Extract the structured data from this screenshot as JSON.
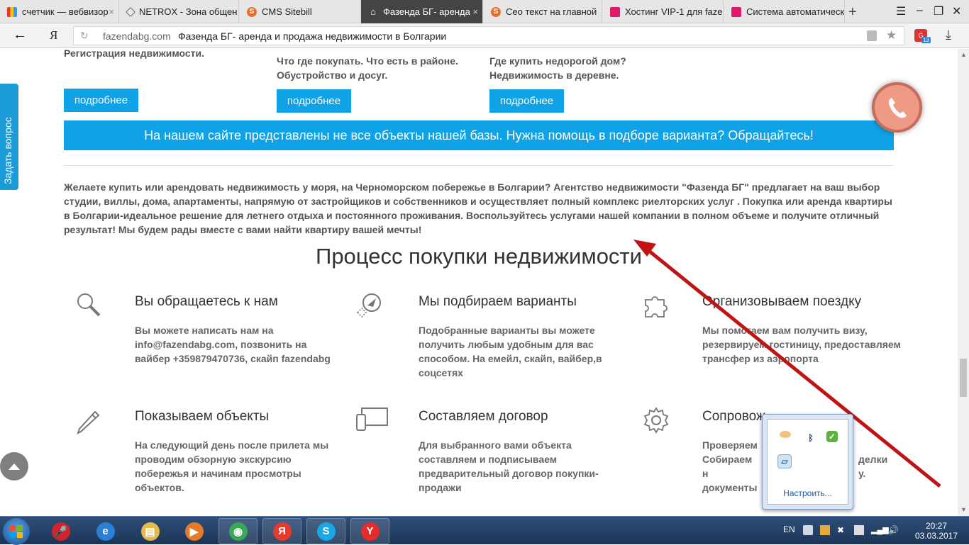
{
  "browser": {
    "tabs": [
      {
        "title": "счетчик — вебвизор",
        "active": false,
        "favicon": "yandex-metrica-icon"
      },
      {
        "title": "NETROX - Зона общен",
        "active": false,
        "favicon": "netrox-icon"
      },
      {
        "title": "CMS Sitebill",
        "active": false,
        "favicon": "sitebill-icon"
      },
      {
        "title": "Фазенда БГ- аренда",
        "active": true,
        "favicon": "house-icon"
      },
      {
        "title": "Сео текст на главной",
        "active": false,
        "favicon": "sitebill-icon"
      },
      {
        "title": "Хостинг VIP-1 для faze",
        "active": false,
        "favicon": "hosting-icon"
      },
      {
        "title": "Система автоматическ",
        "active": false,
        "favicon": "hosting-icon"
      }
    ],
    "address": {
      "domain": "fazendabg.com",
      "page_title": "Фазенда БГ- аренда и продажа недвижимости в Болгарии",
      "yandex_logo": "Я",
      "extension_badge": "13"
    }
  },
  "page": {
    "columns": [
      {
        "text": "Регистрация недвижимости.",
        "button": "подробнее"
      },
      {
        "text": "Что где покупать. Что есть в районе. Обустройство и досуг.",
        "button": "подробнее"
      },
      {
        "text": "Где купить недорогой дом? Недвижимость в деревне.",
        "button": "подробнее"
      }
    ],
    "banner": "На нашем сайте представлены не все объекты нашей базы. Нужна помощь в подборе варианта? Обращайтесь!",
    "intro": "Желаете купить или арендовать недвижимость у моря, на Черноморском побережье в Болгарии? Агентство недвижимости \"Фазенда БГ\" предлагает на ваш выбор студии, виллы, дома, апартаменты, напрямую от застройщиков и собственников и осуществляет полный комплекс риелторских услуг . Покупка или аренда квартиры в Болгарии-идеальное решение для летнего отдыха и постоянного проживания. Воспользуйтесь услугами нашей компании в полном объеме и получите отличный результат! Мы будем рады вместе с вами найти квартиру вашей мечты!",
    "process_title": "Процесс покупки недвижимости",
    "steps": [
      {
        "title": "Вы обращаетесь к нам",
        "text": "Вы можете написать нам на info@fazendabg.com, позвонить на вайбер +359879470736, скайп fazendabg",
        "icon": "search-icon"
      },
      {
        "title": "Мы подбираем варианты",
        "text": "Подобранные варианты вы можете получить любым удобным для вас способом. На емейл, скайп, вайбер,в соцсетях",
        "icon": "compass-icon"
      },
      {
        "title": "Организовываем поездку",
        "text": "Мы помогаем вам получить визу, резервируем гостиницу, предоставляем трансфер из аэропорта",
        "icon": "puzzle-icon"
      },
      {
        "title": "Показываем объекты",
        "text": "На следующий день после прилета мы проводим обзорную экскурсию побережья и начинам просмотры объектов.",
        "icon": "pencil-icon"
      },
      {
        "title": "Составляем договор",
        "text": "Для выбранного вами объекта составляем и подписываем предварительный договор покупки-продажи",
        "icon": "devices-icon"
      },
      {
        "title": "Сопровож",
        "text": "Проверяем Собираем н документы",
        "text_right": "делки у.",
        "icon": "gear-icon"
      }
    ],
    "ask_question": "Задать вопрос"
  },
  "tray_popup": {
    "customize": "Настроить..."
  },
  "taskbar": {
    "lang": "EN",
    "time": "20:27",
    "date": "03.03.2017",
    "items": [
      {
        "icon": "microphone-icon",
        "glyph": "🎤",
        "color": "#d0232a"
      },
      {
        "icon": "internet-explorer-icon",
        "glyph": "e",
        "color": "#2b7fd4"
      },
      {
        "icon": "folder-icon",
        "glyph": "▤",
        "color": "#e5b94a"
      },
      {
        "icon": "media-player-icon",
        "glyph": "▶",
        "color": "#e47a2a"
      },
      {
        "icon": "chrome-icon",
        "glyph": "◉",
        "color": "#3aa757"
      },
      {
        "icon": "yandex-browser-icon",
        "glyph": "Я",
        "color": "#e53a2e"
      },
      {
        "icon": "skype-icon",
        "glyph": "S",
        "color": "#1aa7e8"
      },
      {
        "icon": "yandex-icon",
        "glyph": "Y",
        "color": "#e52b2b"
      }
    ]
  },
  "colors": {
    "accent": "#0fa2e6",
    "arrow": "#c01414",
    "phone": "#ef9a86"
  }
}
